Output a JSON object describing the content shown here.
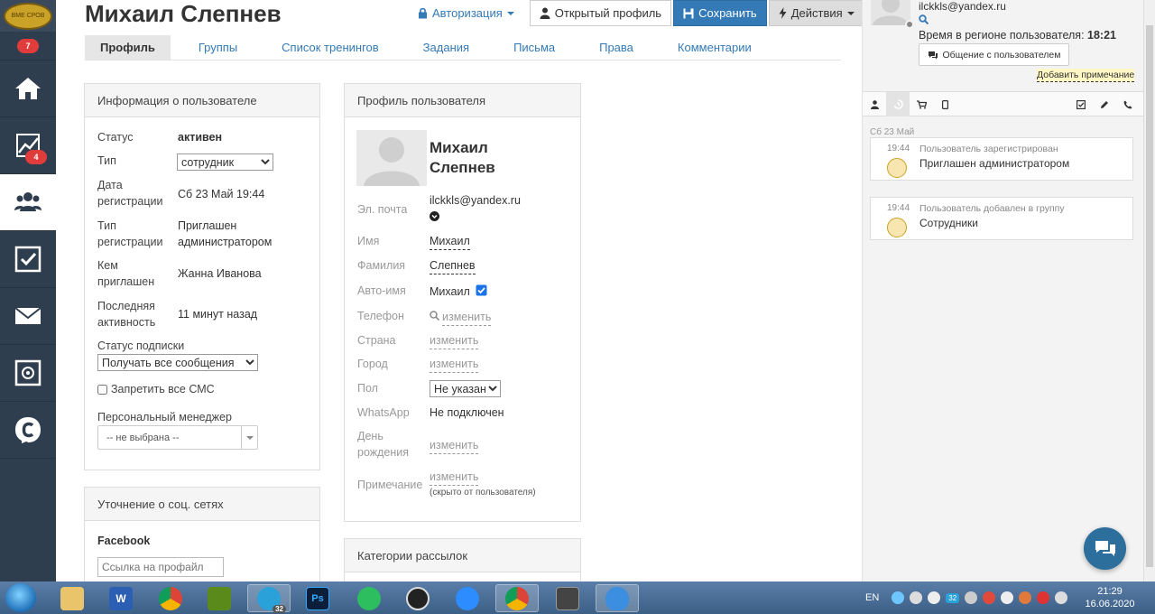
{
  "nav": {
    "logo_text": "ВМЕ СРОВ",
    "badge_top": "7",
    "badge_analytics": "4"
  },
  "header": {
    "title": "Михаил Слепнев",
    "auth_label": "Авторизация",
    "open_profile_label": "Открытый профиль",
    "save_label": "Сохранить",
    "actions_label": "Действия"
  },
  "tabs": [
    {
      "label": "Профиль"
    },
    {
      "label": "Группы"
    },
    {
      "label": "Список тренингов"
    },
    {
      "label": "Задания"
    },
    {
      "label": "Письма"
    },
    {
      "label": "Права"
    },
    {
      "label": "Комментарии"
    }
  ],
  "user_info": {
    "title": "Информация о пользователе",
    "status_label": "Статус",
    "status_value": "активен",
    "type_label": "Тип",
    "type_value": "сотрудник",
    "reg_date_label_1": "Дата",
    "reg_date_label_2": "регистрации",
    "reg_date_value": "Сб 23 Май 19:44",
    "reg_type_label_1": "Тип",
    "reg_type_label_2": "регистрации",
    "reg_type_value_1": "Приглашен",
    "reg_type_value_2": "администратором",
    "invited_label_1": "Кем",
    "invited_label_2": "приглашен",
    "invited_value": "Жанна Иванова",
    "last_active_label_1": "Последняя",
    "last_active_label_2": "активность",
    "last_active_value": "11 минут назад",
    "subscription_label": "Статус подписки",
    "subscription_value": "Получать все сообщения",
    "sms_label": "Запретить все СМС",
    "manager_label": "Персональный менеджер",
    "manager_value": "-- не выбрана --"
  },
  "social": {
    "title": "Уточнение о соц. сетях",
    "facebook_label": "Facebook",
    "facebook_placeholder": "Ссылка на профайл"
  },
  "profile": {
    "title": "Профиль пользователя",
    "name_line1": "Михаил",
    "name_line2": "Слепнев",
    "email_label": "Эл. почта",
    "email_value": "ilckkls@yandex.ru",
    "first_name_label": "Имя",
    "first_name_value": "Михаил",
    "last_name_label": "Фамилия",
    "last_name_value": "Слепнев",
    "auto_name_label": "Авто-имя",
    "auto_name_value": "Михаил",
    "phone_label": "Телефон",
    "change_link": "изменить",
    "country_label": "Страна",
    "city_label": "Город",
    "gender_label": "Пол",
    "gender_value": "Не указан",
    "whatsapp_label": "WhatsApp",
    "whatsapp_value": "Не подключен",
    "birthday_label_1": "День",
    "birthday_label_2": "рождения",
    "note_label": "Примечание",
    "note_hint": "(скрыто от пользователя)"
  },
  "mailing": {
    "title": "Категории рассылок"
  },
  "right": {
    "email": "ilckkls@yandex.ru",
    "region_time_label": "Время в регионе пользователя:",
    "region_time_value": "18:21",
    "chat_button": "Общение с пользователем",
    "add_note": "Добавить примечание",
    "date_header": "Сб 23 Май",
    "events": [
      {
        "time": "19:44",
        "title": "Пользователь зарегистрирован",
        "text": "Приглашен администратором"
      },
      {
        "time": "19:44",
        "title": "Пользователь добавлен в группу",
        "text": "Сотрудники"
      }
    ]
  },
  "taskbar": {
    "tg_badge": "32",
    "ps_label": "Ps",
    "word_label": "W",
    "lang": "EN",
    "tray_badge": "32",
    "time": "21:29",
    "date": "16.06.2020"
  },
  "colors": {
    "nav_bg": "#2f3e4e",
    "link": "#337ab7",
    "primary": "#337ab7",
    "badge": "#e03c3c"
  }
}
